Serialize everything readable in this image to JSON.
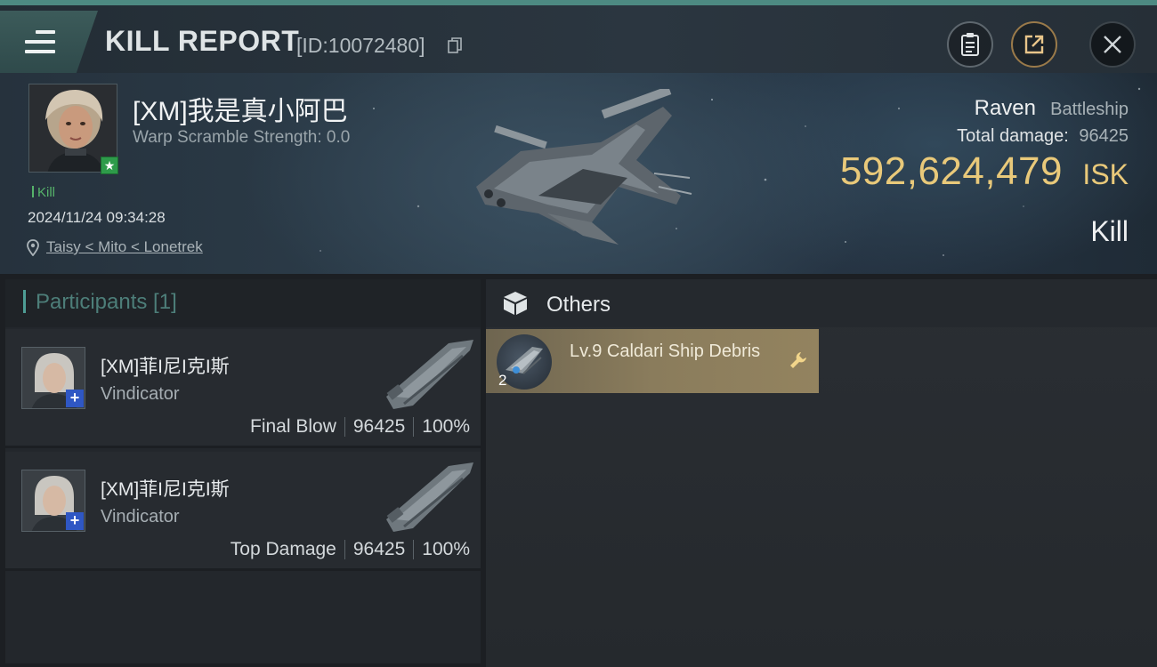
{
  "header": {
    "title": "KILL REPORT",
    "report_id": "[ID:10072480]",
    "icons": [
      "menu-icon",
      "copy-icon",
      "clipboard-icon",
      "share-icon",
      "close-icon"
    ],
    "accent_color": "#4d8a82"
  },
  "victim": {
    "name": "[XM]我是真小阿巴",
    "warp_scramble": "Warp Scramble Strength: 0.0",
    "kill_tag": "Kill",
    "timestamp": "2024/11/24 09:34:28",
    "location": "Taisy < Mito < Lonetrek"
  },
  "summary": {
    "ship_name": "Raven",
    "ship_class": "Battleship",
    "total_damage_label": "Total damage:",
    "total_damage_value": "96425",
    "isk_value": "592,624,479",
    "isk_unit": "ISK",
    "result_label": "Kill",
    "isk_color": "#e9c97a"
  },
  "participants": {
    "title": "Participants [1]",
    "rows": [
      {
        "name": "[XM]菲I尼I克I斯",
        "ship": "Vindicator",
        "role": "Final Blow",
        "damage": "96425",
        "percent": "100%"
      },
      {
        "name": "[XM]菲I尼I克I斯",
        "ship": "Vindicator",
        "role": "Top Damage",
        "damage": "96425",
        "percent": "100%"
      }
    ]
  },
  "others": {
    "title": "Others",
    "items": [
      {
        "name": "Lv.9 Caldari Ship Debris",
        "count": "2",
        "icon": "wrench-icon"
      }
    ]
  }
}
